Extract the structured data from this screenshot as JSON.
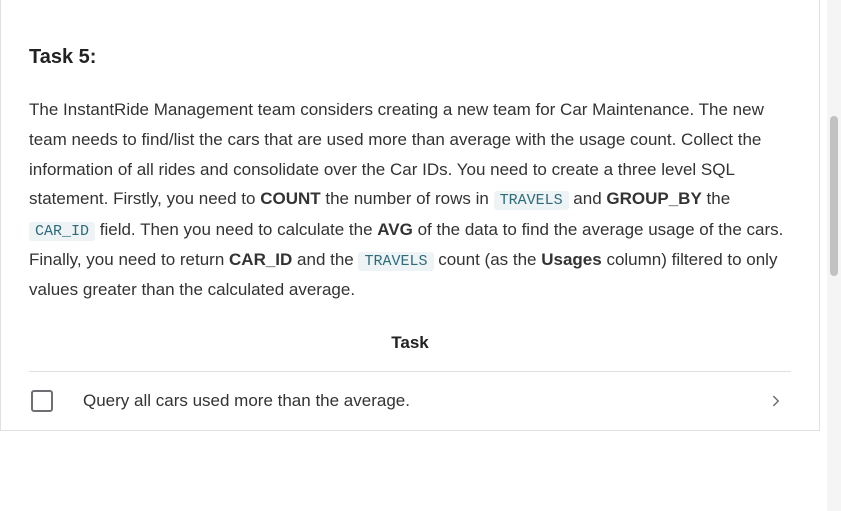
{
  "task": {
    "title": "Task 5:",
    "paragraph_segments": [
      {
        "text": "The InstantRide Management team considers creating a new team for Car Maintenance. The new team needs to find/list the cars that are used more than average with the usage count. Collect the information of all rides and consolidate over the Car IDs. You need to create a three level SQL statement. Firstly, you need to "
      },
      {
        "bold": true,
        "text": "COUNT"
      },
      {
        "text": " the number of rows in "
      },
      {
        "code": true,
        "text": "TRAVELS"
      },
      {
        "text": " and "
      },
      {
        "bold": true,
        "text": "GROUP_BY"
      },
      {
        "text": " the "
      },
      {
        "code": true,
        "text": "CAR_ID"
      },
      {
        "text": " field. Then you need to calculate the "
      },
      {
        "bold": true,
        "text": "AVG"
      },
      {
        "text": " of the data to find the average usage of the cars. Finally, you need to return "
      },
      {
        "bold": true,
        "text": "CAR_ID"
      },
      {
        "text": " and the "
      },
      {
        "code": true,
        "text": "TRAVELS"
      },
      {
        "text": " count (as the "
      },
      {
        "bold": true,
        "text": "Usages"
      },
      {
        "text": " column) filtered to only values greater than the calculated average."
      }
    ],
    "sub_heading": "Task",
    "item_label": "Query all cars used more than the average."
  }
}
